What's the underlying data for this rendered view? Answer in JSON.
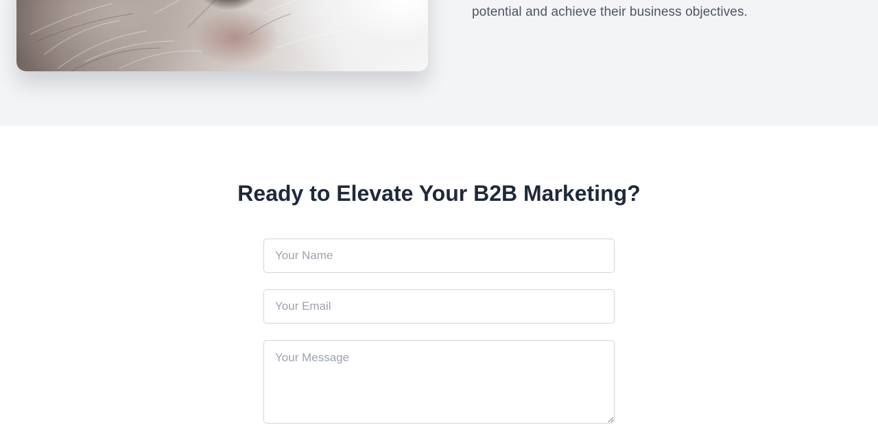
{
  "about": {
    "text": "potential and achieve their business objectives."
  },
  "contact": {
    "title": "Ready to Elevate Your B2B Marketing?",
    "name_placeholder": "Your Name",
    "email_placeholder": "Your Email",
    "message_placeholder": "Your Message"
  }
}
